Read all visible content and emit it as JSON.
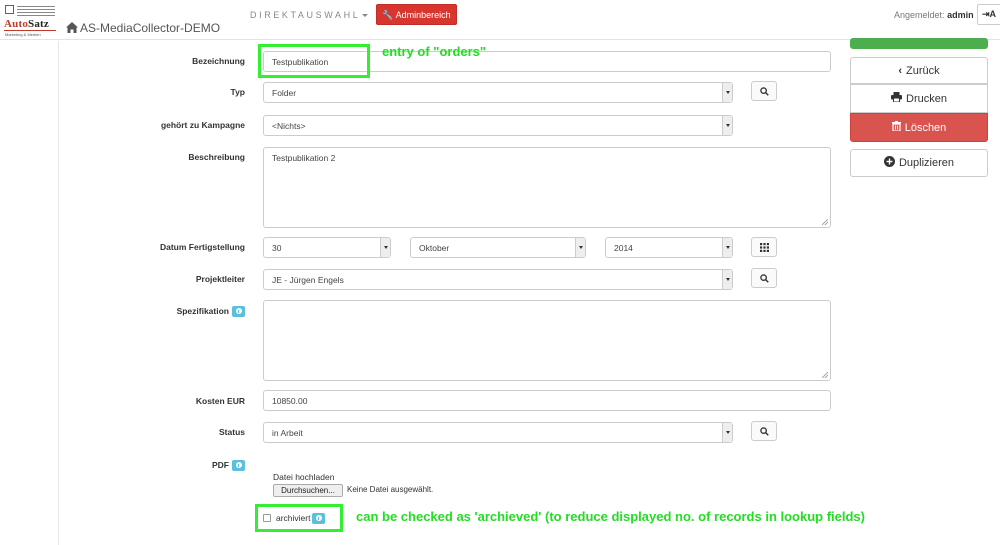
{
  "header": {
    "logo_brand_a": "Auto",
    "logo_brand_b": "Satz",
    "logo_sub": "Marketing & Medien",
    "app_title": "AS-MediaCollector-DEMO",
    "direktauswahl": "DIREKTAUSWAHL",
    "admin_button": "Adminbereich",
    "logged_in_label": "Angemeldet:",
    "logged_in_user": "admin",
    "logout_label": "A"
  },
  "form": {
    "bezeichnung": {
      "label": "Bezeichnung",
      "value": "Testpublikation"
    },
    "typ": {
      "label": "Typ",
      "value": "Folder"
    },
    "kampagne": {
      "label": "gehört zu Kampagne",
      "value": "<Nichts>"
    },
    "beschreibung": {
      "label": "Beschreibung",
      "value": "Testpublikation 2"
    },
    "datum": {
      "label": "Datum Fertigstellung",
      "day": "30",
      "month": "Oktober",
      "year": "2014"
    },
    "projektleiter": {
      "label": "Projektleiter",
      "value": "JE - Jürgen Engels"
    },
    "spezifikation": {
      "label": "Spezifikation",
      "value": ""
    },
    "kosten": {
      "label": "Kosten EUR",
      "value": "10850.00"
    },
    "status": {
      "label": "Status",
      "value": "in Arbeit"
    },
    "pdf": {
      "label": "PDF",
      "upload_label": "Datei hochladen",
      "browse_button": "Durchsuchen...",
      "no_file": "Keine Datei ausgewählt."
    },
    "archiviert": {
      "label": "archiviert",
      "checked": false
    }
  },
  "actions": {
    "back": "Zurück",
    "print": "Drucken",
    "delete": "Löschen",
    "duplicate": "Duplizieren"
  },
  "annotations": {
    "orders": "entry of \"orders\"",
    "archived": "can be checked as 'archieved' (to reduce displayed no. of records in lookup fields)"
  },
  "colors": {
    "accent_red": "#d9352f",
    "info_blue": "#5bc0de",
    "annotation_green": "#33ee33"
  }
}
